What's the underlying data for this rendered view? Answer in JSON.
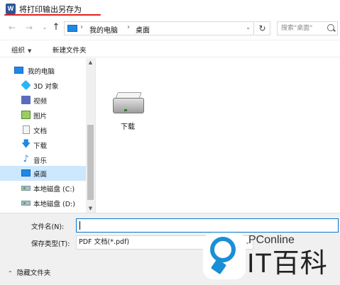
{
  "window": {
    "app_icon": "word-icon",
    "app_icon_letter": "W",
    "title": "将打印输出另存为",
    "accent_color": "#e02020"
  },
  "address": {
    "back_icon": "←",
    "forward_icon": "→",
    "history_icon": "⌄",
    "up_icon": "↑",
    "separator": "›",
    "segments": [
      "我的电脑",
      "桌面"
    ],
    "dropdown_icon": "⌄",
    "refresh_icon": "↻",
    "search_placeholder": "搜索\"桌面\""
  },
  "toolbar": {
    "organize_label": "组织",
    "organize_caret": "▼",
    "new_folder_label": "新建文件夹"
  },
  "sidebar": {
    "items": [
      {
        "label": "我的电脑",
        "icon": "computer-icon"
      },
      {
        "label": "3D 对象",
        "icon": "3d-objects-icon"
      },
      {
        "label": "视频",
        "icon": "videos-icon"
      },
      {
        "label": "图片",
        "icon": "pictures-icon"
      },
      {
        "label": "文档",
        "icon": "documents-icon"
      },
      {
        "label": "下载",
        "icon": "downloads-icon",
        "glyph": "🡇"
      },
      {
        "label": "音乐",
        "icon": "music-icon",
        "glyph": "♪"
      },
      {
        "label": "桌面",
        "icon": "desktop-icon",
        "selected": true
      },
      {
        "label": "本地磁盘 (C:)",
        "icon": "drive-icon"
      },
      {
        "label": "本地磁盘 (D:)",
        "icon": "drive-icon"
      }
    ],
    "scroll_up": "▲",
    "scroll_down": "▼"
  },
  "content": {
    "items": [
      {
        "label": "下载",
        "icon": "drive-icon"
      }
    ]
  },
  "save": {
    "filename_label": "文件名(N):",
    "filename_value": "",
    "filetype_label": "保存类型(T):",
    "filetype_value": "PDF 文档(*.pdf)",
    "filetype_chevron": "⌄",
    "hide_folders_label": "隐藏文件夹",
    "hide_folders_icon": "⌃"
  },
  "watermark": {
    "brand_small": "PConline",
    "brand_large": "IT百科",
    "brand_color": "#1a8fd6"
  }
}
